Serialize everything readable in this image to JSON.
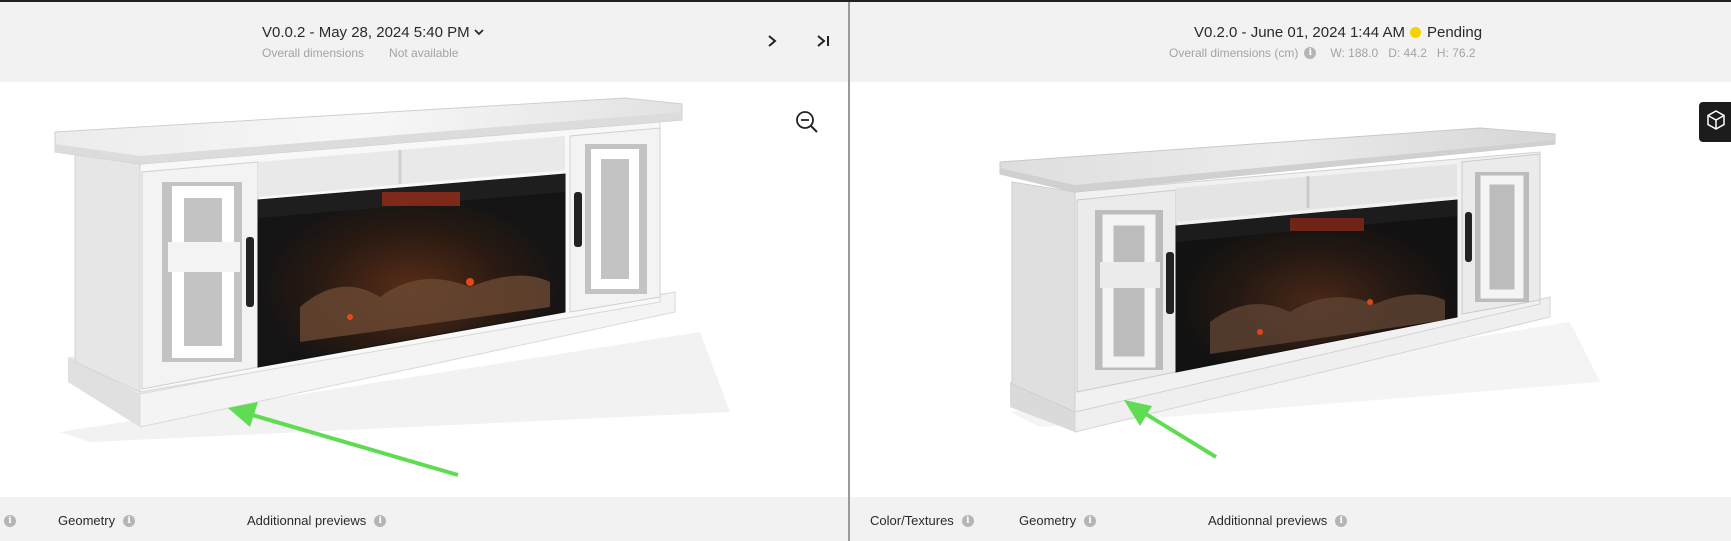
{
  "left": {
    "version_label": "V0.0.2 - May 28, 2024 5:40 PM",
    "dimensions_label": "Overall dimensions",
    "dimensions_value": "Not available",
    "tabs": [
      {
        "label": "Geometry"
      },
      {
        "label": "Additionnal previews"
      }
    ]
  },
  "right": {
    "version_label": "V0.2.0 - June 01, 2024 1:44 AM",
    "status": "Pending",
    "status_color": "#f5d200",
    "dimensions_label": "Overall dimensions (cm)",
    "width": "W: 188.0",
    "depth": "D: 44.2",
    "height": "H: 76.2",
    "tabs": [
      {
        "label": "Color/Textures"
      },
      {
        "label": "Geometry"
      },
      {
        "label": "Additionnal previews"
      }
    ]
  },
  "icons": {
    "version_dropdown": "chevron-down-icon",
    "next": "chevron-right-icon",
    "last": "skip-to-end-icon",
    "zoom": "zoom-out-icon",
    "view3d": "cube-icon",
    "info": "info-icon"
  },
  "colors": {
    "annotation_arrow": "#5fdc52",
    "pending_dot": "#f5d200",
    "background": "#f2f2f2"
  }
}
